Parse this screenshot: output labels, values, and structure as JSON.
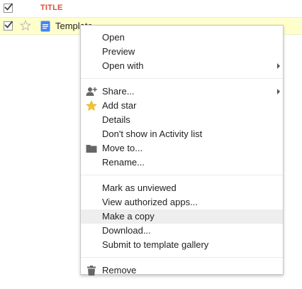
{
  "list": {
    "header": {
      "title_column": "TITLE"
    },
    "row": {
      "file_name": "Template",
      "file_icon": "doc-icon",
      "star_icon": "star-outline-icon"
    }
  },
  "colors": {
    "title_header": "#dd4b39",
    "selected_row": "#ffffcc",
    "menu_highlight": "#eeeeee",
    "doc_blue": "#4285f4",
    "star_gold": "#f4c430"
  },
  "context_menu": {
    "group1": {
      "open": "Open",
      "preview": "Preview",
      "open_with": "Open with"
    },
    "group2": {
      "share": "Share...",
      "add_star": "Add star",
      "details": "Details",
      "dont_show": "Don't show in Activity list",
      "move_to": "Move to...",
      "rename": "Rename..."
    },
    "group3": {
      "mark_unviewed": "Mark as unviewed",
      "view_apps": "View authorized apps...",
      "make_copy": "Make a copy",
      "download": "Download...",
      "submit_template": "Submit to template gallery"
    },
    "group4": {
      "remove": "Remove"
    },
    "highlighted_item": "Make a copy"
  }
}
